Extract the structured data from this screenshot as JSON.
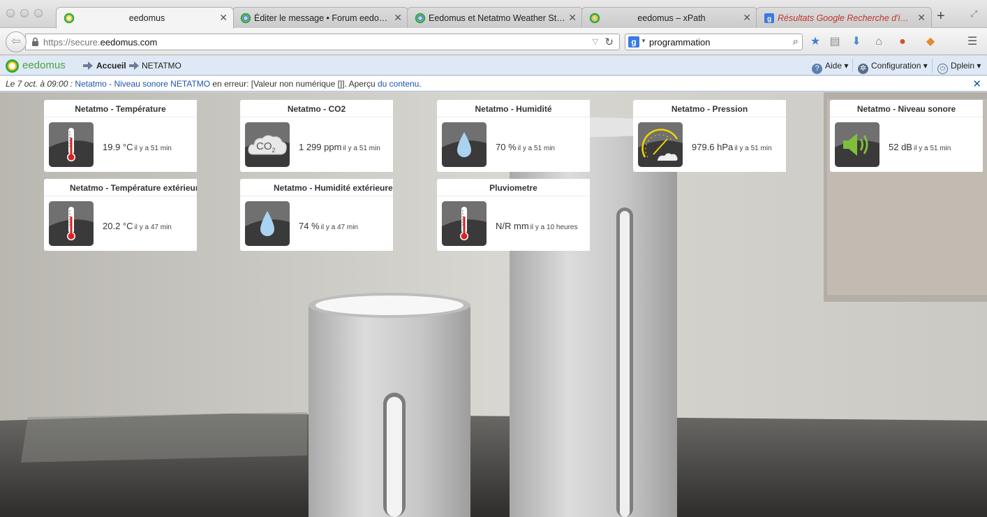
{
  "browser": {
    "tabs": [
      {
        "label": "eedomus",
        "active": true
      },
      {
        "label": "Éditer le message • Forum eedom…",
        "active": false
      },
      {
        "label": "Eedomus et Netatmo Weather Sta…",
        "active": false
      },
      {
        "label": "eedomus – xPath",
        "active": false
      },
      {
        "label": "Résultats Google Recherche d'ima…",
        "active": false
      }
    ],
    "new_tab": "+",
    "url_prefix": "https://secure.",
    "url_domain": "eedomus.com",
    "search_text": "programmation",
    "search_engine_letter": "g"
  },
  "app": {
    "logo": "eedomus",
    "breadcrumb": [
      "Accueil",
      "NETATMO"
    ],
    "menu": {
      "help": "Aide",
      "config": "Configuration",
      "user": "Dplein"
    }
  },
  "message": {
    "date": "Le 7 oct. à 09:00 :",
    "link1": "Netatmo - Niveau sonore NETATMO",
    "text1": " en erreur: [Valeur non numérique []]. Aperçu ",
    "link2": "du contenu",
    "text2": "."
  },
  "widgets": [
    {
      "title": "Netatmo - Température",
      "value": "19.9 °C",
      "time": "il y a 51 min",
      "icon": "thermometer-icon"
    },
    {
      "title": "Netatmo - CO2",
      "value": "1 299 ppm",
      "time": "il y a 51 min",
      "icon": "co2-cloud-icon"
    },
    {
      "title": "Netatmo - Humidité",
      "value": "70 %",
      "time": "il y a 51 min",
      "icon": "water-drop-icon"
    },
    {
      "title": "Netatmo - Pression",
      "value": "979.6 hPa",
      "time": "il y a 51 min",
      "icon": "barometer-icon"
    },
    {
      "title": "Netatmo - Niveau sonore",
      "value": "52 dB",
      "time": "il y a 51 min",
      "icon": "speaker-icon"
    },
    {
      "title": "Netatmo - Température extérieur",
      "value": "20.2 °C",
      "time": "il y a 47 min",
      "icon": "thermometer-icon"
    },
    {
      "title": "Netatmo - Humidité extérieure",
      "value": "74 %",
      "time": "il y a 47 min",
      "icon": "water-drop-icon"
    },
    {
      "title": "Pluviometre",
      "value": "N/R mm",
      "time": "il y a 10 heures",
      "icon": "thermometer-icon"
    }
  ],
  "co2_label": "CO",
  "co2_sub": "2",
  "colors": {
    "appbar": "#dfe9f6",
    "link": "#1d56a8",
    "logo_green": "#4aa43b",
    "logo_yellow": "#f2c500"
  }
}
